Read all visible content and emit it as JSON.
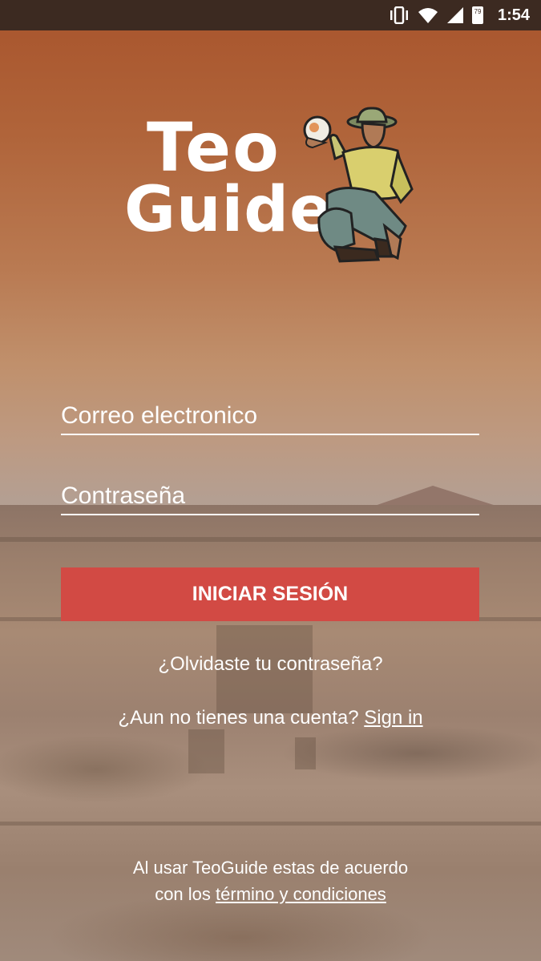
{
  "status_bar": {
    "time": "1:54",
    "battery_level": "79",
    "icons": [
      "vibrate-icon",
      "wifi-icon",
      "signal-icon",
      "battery-icon"
    ]
  },
  "logo": {
    "line1": "Teo",
    "line2": "Guide"
  },
  "form": {
    "email_placeholder": "Correo electronico",
    "password_placeholder": "Contraseña",
    "login_button": "INICIAR SESIÓN"
  },
  "links": {
    "forgot_password": "¿Olvidaste tu contraseña?",
    "no_account_text": "¿Aun no tienes una cuenta?",
    "sign_in_link": "Sign in"
  },
  "terms": {
    "line1": "Al usar TeoGuide estas de acuerdo",
    "line2_prefix": "con los",
    "link": "término y condiciones"
  },
  "colors": {
    "status_bar": "#3c2a21",
    "button": "#d24a44",
    "text": "#ffffff"
  }
}
